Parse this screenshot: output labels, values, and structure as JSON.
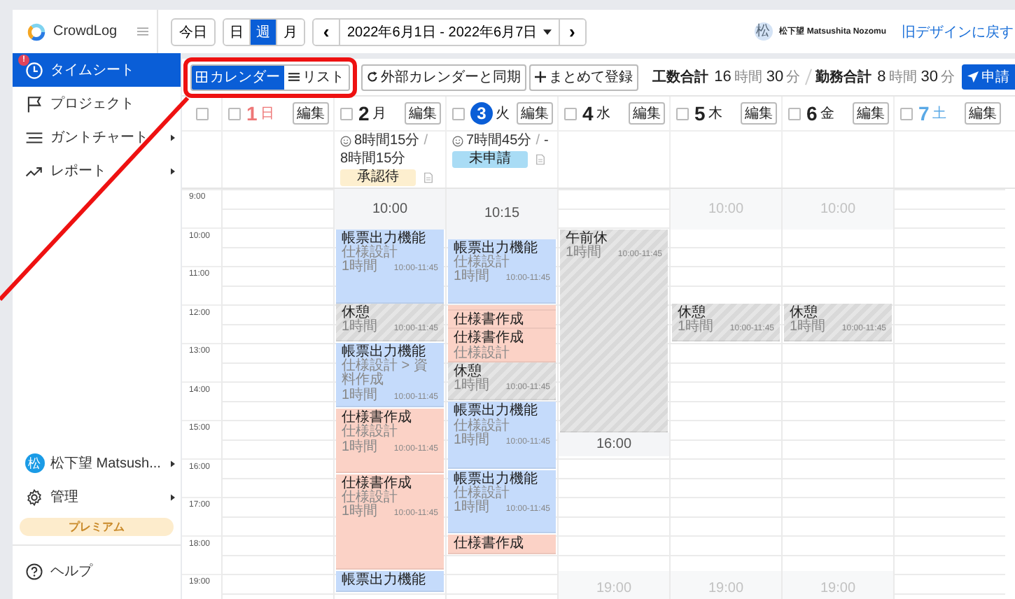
{
  "app": {
    "name": "CrowdLog"
  },
  "topbar": {
    "today": "今日",
    "ranges": [
      {
        "label": "日",
        "selected": false
      },
      {
        "label": "週",
        "selected": true
      },
      {
        "label": "月",
        "selected": false
      }
    ],
    "prev": "‹",
    "date_range": "2022年6月1日 - 2022年6月7日",
    "next": "›",
    "avatar": "松",
    "user": "松下望 Matsushita Nozomu",
    "old_design_link": "旧デザインに戻す"
  },
  "sidebar": {
    "items": [
      {
        "label": "タイムシート",
        "selected": true,
        "badge": "!",
        "expandable": false
      },
      {
        "label": "プロジェクト",
        "selected": false,
        "expandable": false
      },
      {
        "label": "ガントチャート",
        "selected": false,
        "expandable": true
      },
      {
        "label": "レポート",
        "selected": false,
        "expandable": true
      }
    ],
    "user": {
      "avatar": "松",
      "label": "松下望 Matsush...",
      "expandable": true
    },
    "admin": {
      "label": "管理",
      "expandable": true
    },
    "plan": "プレミアム",
    "help": "ヘルプ"
  },
  "toolbar": {
    "views": [
      {
        "label": "カレンダー",
        "selected": true
      },
      {
        "label": "リスト",
        "selected": false
      }
    ],
    "sync": "外部カレンダーと同期",
    "bulk": "まとめて登録",
    "totals": [
      {
        "label": "工数合計",
        "hours": "16",
        "hours_unit": "時間",
        "minutes": "30",
        "minutes_unit": "分"
      },
      {
        "label": "勤務合計",
        "hours": "8",
        "hours_unit": "時間",
        "minutes": "30",
        "minutes_unit": "分"
      }
    ],
    "submit": "申請"
  },
  "calendar": {
    "select_all_checked": false,
    "hours": [
      "9:00",
      "10:00",
      "11:00",
      "12:00",
      "13:00",
      "14:00",
      "15:00",
      "16:00",
      "17:00",
      "18:00",
      "19:00"
    ],
    "days": [
      {
        "number": "1",
        "weekday": "日",
        "color": "#ee7777",
        "today": false,
        "checked": false,
        "edit": "編集"
      },
      {
        "number": "2",
        "weekday": "月",
        "color": "#222222",
        "today": false,
        "checked": false,
        "edit": "編集",
        "summary": {
          "worked": "8時間15分",
          "separator": "/",
          "submitted": "8時間15分",
          "status": "承認待",
          "color": "#fdefcf"
        },
        "items": [
          {
            "kind": "band",
            "text": "10:00",
            "muted": false
          },
          {
            "kind": "event",
            "color": "#c5dbfb",
            "title": "帳票出力機能",
            "subtitle": "仕様設計",
            "duration": "1時間",
            "time": "10:00-11:45"
          },
          {
            "kind": "break",
            "title": "休憩",
            "duration": "1時間",
            "time": "10:00-11:45"
          },
          {
            "kind": "event",
            "color": "#c5dbfb",
            "title": "帳票出力機能",
            "subtitle": "仕様設計 > 資料作成",
            "duration": "1時間",
            "time": "10:00-11:45"
          },
          {
            "kind": "event",
            "color": "#fbd2c6",
            "title": "仕様書作成",
            "subtitle": "仕様設計",
            "duration": "1時間",
            "time": "10:00-11:45"
          },
          {
            "kind": "event",
            "color": "#fbd2c6",
            "title": "仕様書作成",
            "subtitle": "仕様設計",
            "duration": "1時間",
            "time": "10:00-11:45"
          },
          {
            "kind": "event",
            "color": "#c5dbfb",
            "title": "帳票出力機能"
          }
        ]
      },
      {
        "number": "3",
        "weekday": "火",
        "color": "#222222",
        "today": true,
        "checked": false,
        "edit": "編集",
        "summary": {
          "worked": "7時間45分",
          "separator": "/",
          "submitted": "-",
          "status": "未申請",
          "color": "#a9dcf5"
        },
        "items": [
          {
            "kind": "band",
            "text": "10:15",
            "muted": false
          },
          {
            "kind": "event",
            "color": "#c5dbfb",
            "title": "帳票出力機能",
            "subtitle": "仕様設計",
            "duration": "1時間",
            "time": "10:00-11:45"
          },
          {
            "kind": "event",
            "color": "#fbd2c6"
          },
          {
            "kind": "event",
            "color": "#fbd2c6",
            "title": "仕様書作成"
          },
          {
            "kind": "event",
            "color": "#fbd2c6",
            "title": "仕様書作成",
            "subtitle": "仕様設計"
          },
          {
            "kind": "break",
            "title": "休憩",
            "duration": "1時間",
            "time": "10:00-11:45"
          },
          {
            "kind": "event",
            "color": "#c5dbfb",
            "title": "帳票出力機能",
            "subtitle": "仕様設計",
            "duration": "1時間",
            "time": "10:00-11:45"
          },
          {
            "kind": "event",
            "color": "#c5dbfb",
            "title": "帳票出力機能",
            "subtitle": "仕様設計",
            "duration": "1時間",
            "time": "10:00-11:45"
          },
          {
            "kind": "event",
            "color": "#fbd2c6",
            "title": "仕様書作成"
          }
        ]
      },
      {
        "number": "4",
        "weekday": "水",
        "color": "#222222",
        "today": false,
        "checked": false,
        "edit": "編集",
        "items": [
          {
            "kind": "break",
            "title": "午前休",
            "duration": "1時間",
            "time": "10:00-11:45"
          },
          {
            "kind": "band",
            "text": "16:00",
            "muted": false
          },
          {
            "kind": "band",
            "text": "19:00",
            "muted": true
          }
        ]
      },
      {
        "number": "5",
        "weekday": "木",
        "color": "#222222",
        "today": false,
        "checked": false,
        "edit": "編集",
        "items": [
          {
            "kind": "band",
            "text": "10:00",
            "muted": true
          },
          {
            "kind": "break",
            "title": "休憩",
            "duration": "1時間",
            "time": "10:00-11:45"
          },
          {
            "kind": "band",
            "text": "19:00",
            "muted": true
          }
        ]
      },
      {
        "number": "6",
        "weekday": "金",
        "color": "#222222",
        "today": false,
        "checked": false,
        "edit": "編集",
        "items": [
          {
            "kind": "band",
            "text": "10:00",
            "muted": true
          },
          {
            "kind": "break",
            "title": "休憩",
            "duration": "1時間",
            "time": "10:00-11:45"
          },
          {
            "kind": "band",
            "text": "19:00",
            "muted": true
          }
        ]
      },
      {
        "number": "7",
        "weekday": "土",
        "color": "#5aa9e6",
        "today": false,
        "checked": false,
        "edit": "編集"
      }
    ]
  },
  "annotation": {
    "kind": "callout"
  }
}
